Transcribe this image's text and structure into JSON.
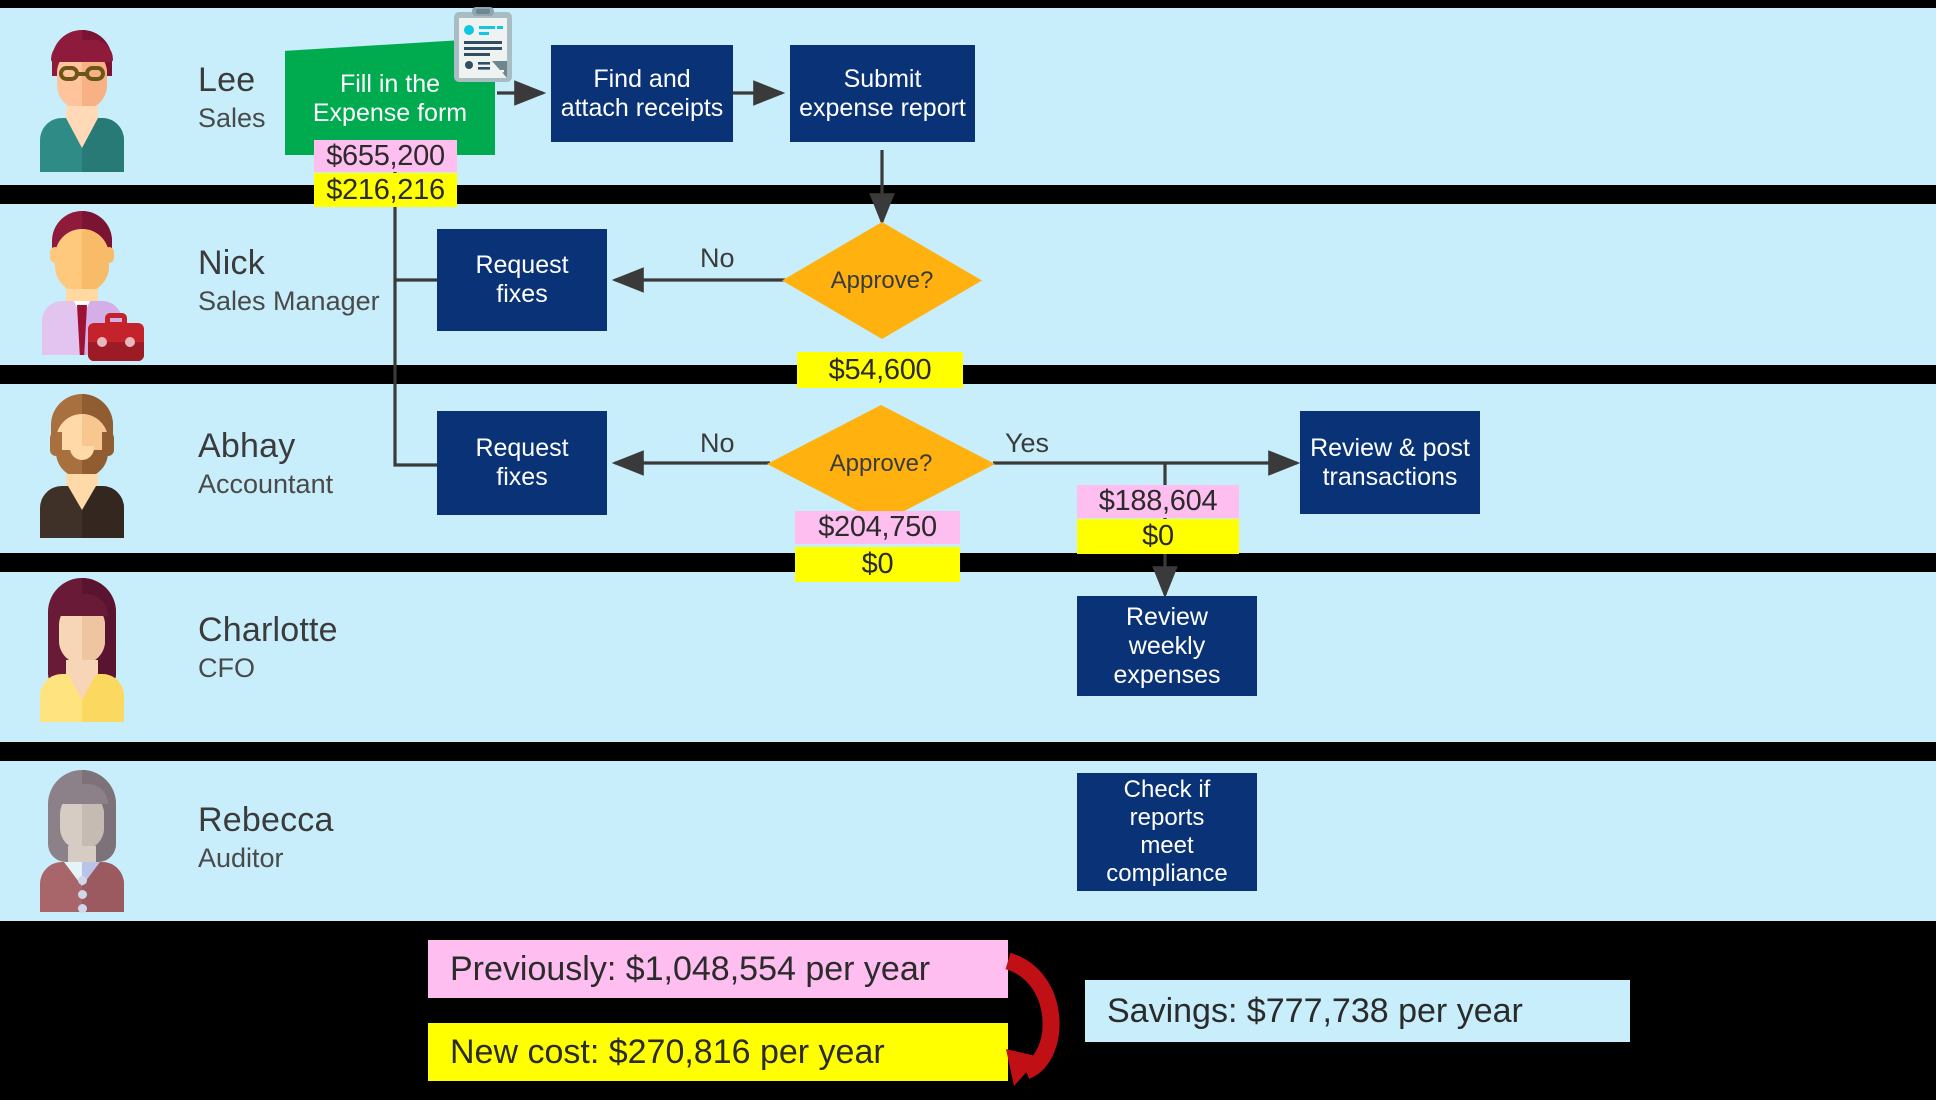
{
  "lanes": [
    {
      "actor": {
        "name": "Lee",
        "role": "Sales"
      }
    },
    {
      "actor": {
        "name": "Nick",
        "role": "Sales Manager"
      }
    },
    {
      "actor": {
        "name": "Abhay",
        "role": "Accountant"
      }
    },
    {
      "actor": {
        "name": "Charlotte",
        "role": "CFO"
      }
    },
    {
      "actor": {
        "name": "Rebecca",
        "role": "Auditor"
      }
    }
  ],
  "nodes": {
    "fill_expense_form": "Fill in the\nExpense form",
    "find_attach_receipts": "Find and\nattach receipts",
    "submit_expense_report": "Submit\nexpense report",
    "request_fixes_manager": "Request\nfixes",
    "request_fixes_accountant": "Request\nfixes",
    "approve_manager": "Approve?",
    "approve_accountant": "Approve?",
    "review_post_transactions": "Review & post\ntransactions",
    "review_weekly_expenses": "Review weekly\nexpenses",
    "check_compliance": "Check if\nreports\nmeet\ncompliance"
  },
  "edge_labels": {
    "manager_no": "No",
    "accountant_no": "No",
    "accountant_yes": "Yes"
  },
  "costs": {
    "expense_form_previous": "$655,200",
    "expense_form_new": "$216,216",
    "manager_approve_new": "$54,600",
    "accountant_approve_previous": "$204,750",
    "accountant_approve_new": "$0",
    "transactions_previous": "$188,604",
    "transactions_new": "$0"
  },
  "summary": {
    "previously": "Previously: $1,048,554 per year",
    "new_cost": "New cost: $270,816 per year",
    "savings": "Savings: $777,738 per year"
  },
  "icons": {
    "clipboard": "clipboard-icon",
    "savings_arrow": "curved-arrow-icon"
  },
  "colors": {
    "lane_background": "#c8eefc",
    "process_box": "#0a3377",
    "manual_process": "#00aa4f",
    "decision": "#ffb20f",
    "previous_cost_highlight": "#ffbef0",
    "new_cost_highlight": "#ffff00",
    "savings_arrow": "#c10f16"
  }
}
